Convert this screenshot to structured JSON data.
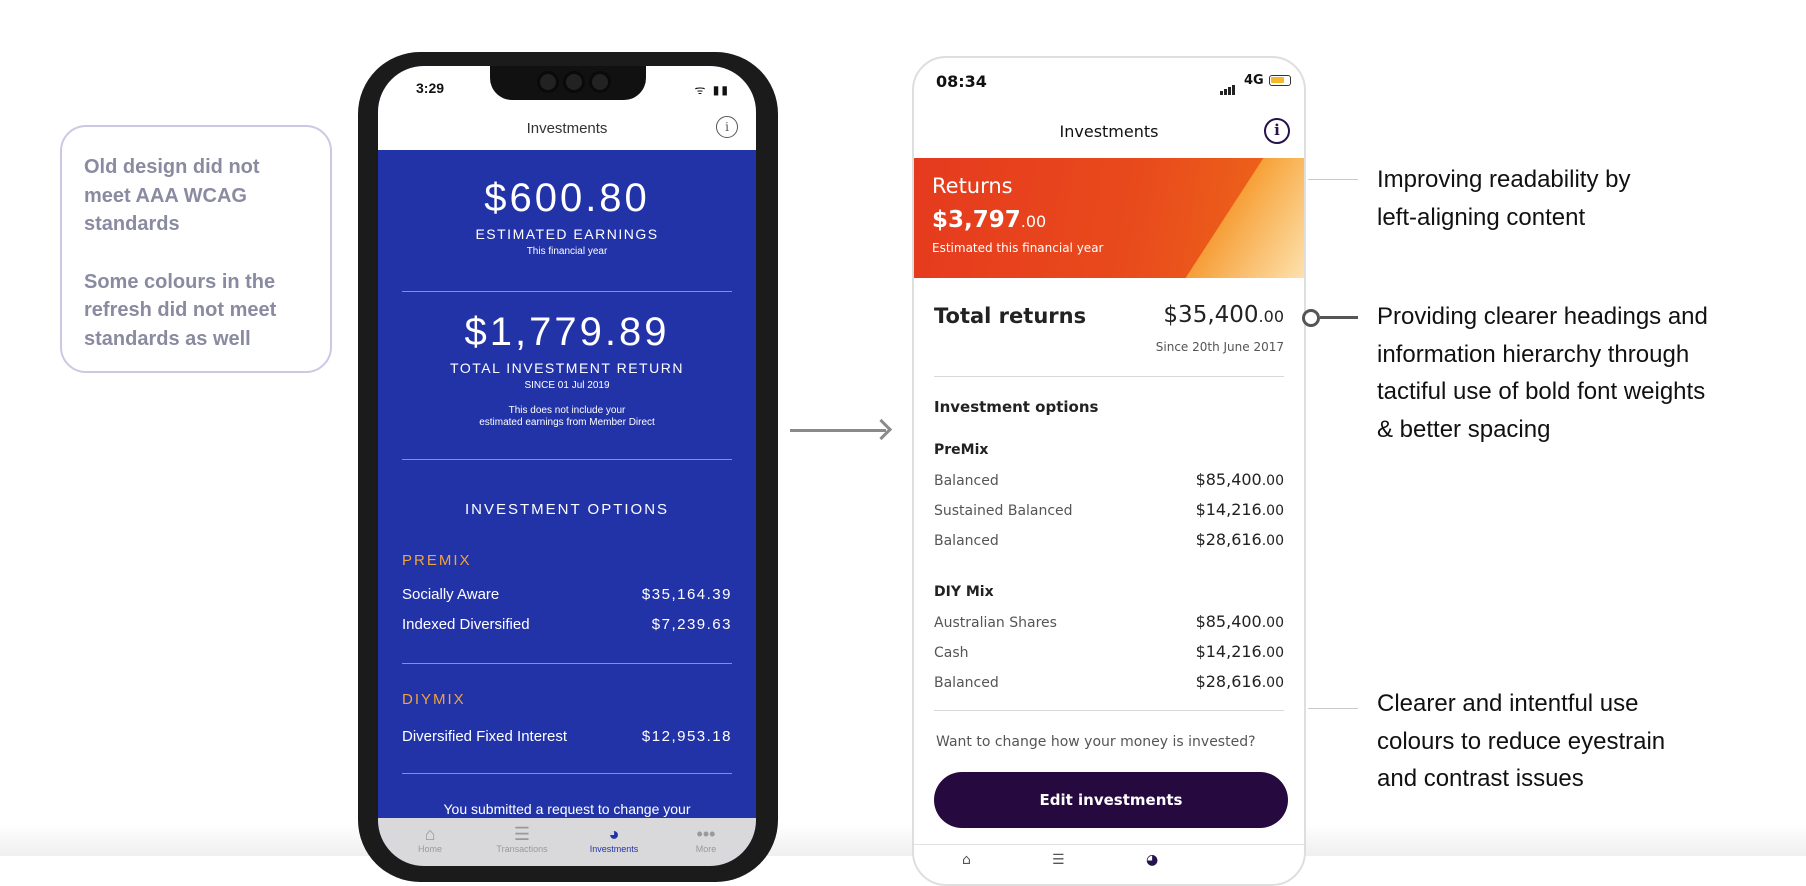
{
  "notes": {
    "p1": "Old design did not meet AAA WCAG standards",
    "p2": "Some colours in the refresh did not meet standards as well"
  },
  "old_app": {
    "status_time": "3:29",
    "title": "Investments",
    "info_icon": "info-icon",
    "earnings_amount": "$600.80",
    "earnings_label": "ESTIMATED EARNINGS",
    "earnings_sub": "This financial year",
    "total_amount": "$1,779.89",
    "total_label": "TOTAL INVESTMENT RETURN",
    "total_since": "SINCE 01 Jul 2019",
    "total_note1": "This does not include your",
    "total_note2": "estimated earnings from Member Direct",
    "options_title": "INVESTMENT OPTIONS",
    "premix_title": "PREMIX",
    "premix_rows": [
      {
        "name": "Socially Aware",
        "value": "$35,164.39"
      },
      {
        "name": "Indexed Diversified",
        "value": "$7,239.63"
      }
    ],
    "diymix_title": "DIYMIX",
    "diymix_rows": [
      {
        "name": "Diversified Fixed Interest",
        "value": "$12,953.18"
      }
    ],
    "footer_text": "You submitted a request to change your",
    "tabs": [
      {
        "label": "Home",
        "icon": "home-icon"
      },
      {
        "label": "Transactions",
        "icon": "list-icon"
      },
      {
        "label": "Investments",
        "icon": "pie-chart-icon"
      },
      {
        "label": "More",
        "icon": "more-icon"
      }
    ],
    "colors": {
      "background": "#2233a8",
      "accent": "#f0a43a"
    }
  },
  "new_app": {
    "status_time": "08:34",
    "network": "4G",
    "title": "Investments",
    "info_icon": "info-icon",
    "returns_label": "Returns",
    "returns_amount": "$3,797",
    "returns_cents": ".00",
    "returns_note": "Estimated this financial year",
    "total_label": "Total returns",
    "total_amount": "$35,400",
    "total_cents": ".00",
    "total_since": "Since 20th June 2017",
    "options_title": "Investment options",
    "premix_title": "PreMix",
    "premix_rows": [
      {
        "name": "Balanced",
        "value": "$85,400",
        "cents": ".00"
      },
      {
        "name": "Sustained Balanced",
        "value": "$14,216",
        "cents": ".00"
      },
      {
        "name": "Balanced",
        "value": "$28,616",
        "cents": ".00"
      }
    ],
    "diymix_title": "DIY Mix",
    "diymix_rows": [
      {
        "name": "Australian Shares",
        "value": "$85,400",
        "cents": ".00"
      },
      {
        "name": "Cash",
        "value": "$14,216",
        "cents": ".00"
      },
      {
        "name": "Balanced",
        "value": "$28,616",
        "cents": ".00"
      }
    ],
    "change_question": "Want to change how your money is invested?",
    "edit_button": "Edit investments",
    "colors": {
      "banner": "#e84a1c",
      "button": "#26093f",
      "info": "#26134e"
    }
  },
  "callouts": {
    "c1": [
      "Improving readability by",
      "left-aligning content"
    ],
    "c2": [
      "Providing clearer headings and",
      "information hierarchy through",
      "tactiful use of bold font weights",
      "& better spacing"
    ],
    "c3": [
      "Clearer and intentful use",
      "colours to reduce eyestrain",
      "and contrast issues"
    ]
  }
}
